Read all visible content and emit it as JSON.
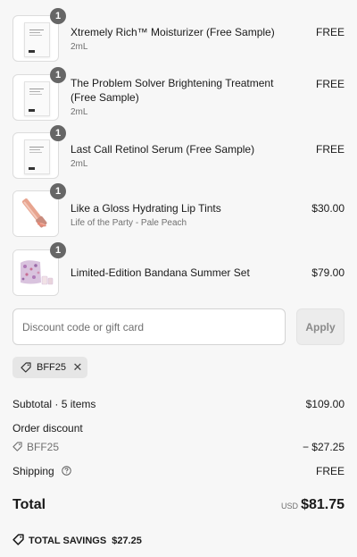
{
  "items": [
    {
      "name": "Xtremely Rich™ Moisturizer (Free Sample)",
      "sub": "2mL",
      "price": "FREE",
      "qty": "1"
    },
    {
      "name": "The Problem Solver Brightening Treatment (Free Sample)",
      "sub": "2mL",
      "price": "FREE",
      "qty": "1"
    },
    {
      "name": "Last Call Retinol Serum (Free Sample)",
      "sub": "2mL",
      "price": "FREE",
      "qty": "1"
    },
    {
      "name": "Like a Gloss Hydrating Lip Tints",
      "sub": "Life of the Party - Pale Peach",
      "price": "$30.00",
      "qty": "1"
    },
    {
      "name": "Limited-Edition Bandana Summer Set",
      "sub": "",
      "price": "$79.00",
      "qty": "1"
    }
  ],
  "discount": {
    "placeholder": "Discount code or gift card",
    "apply_label": "Apply",
    "applied_code": "BFF25",
    "remove_glyph": "✕"
  },
  "summary": {
    "subtotal_label": "Subtotal · 5 items",
    "subtotal_value": "$109.00",
    "order_discount_label": "Order discount",
    "discount_code": "BFF25",
    "discount_value": "− $27.25",
    "shipping_label": "Shipping",
    "shipping_value": "FREE",
    "total_label": "Total",
    "currency": "USD",
    "total_value": "$81.75",
    "savings_label": "TOTAL SAVINGS",
    "savings_value": "$27.25"
  },
  "icons": {
    "qty_badge": "qty-badge",
    "tag": "tag-icon",
    "help": "help-circle-icon"
  }
}
